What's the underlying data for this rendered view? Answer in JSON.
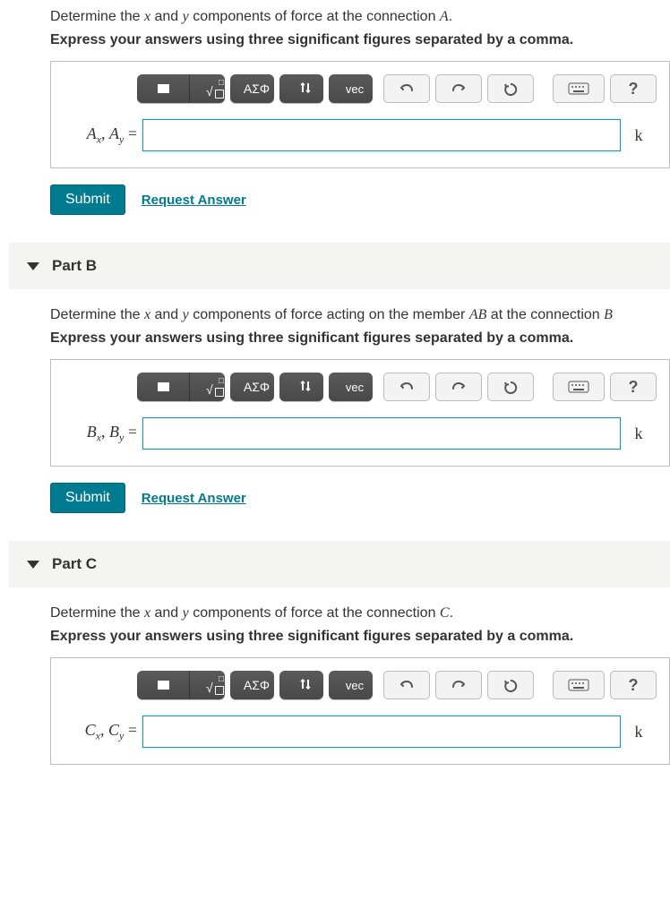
{
  "partA": {
    "prompt_pre": "Determine the ",
    "var1": "x",
    "mid1": " and ",
    "var2": "y",
    "prompt_mid": " components of force at the connection ",
    "conn": "A",
    "prompt_post": ".",
    "instruction": "Express your answers using three significant figures separated by a comma.",
    "lhs_html": "A_x, A_y =",
    "unit": "k",
    "submit": "Submit",
    "request": "Request Answer"
  },
  "partB": {
    "title": "Part B",
    "prompt_pre": "Determine the ",
    "var1": "x",
    "mid1": " and ",
    "var2": "y",
    "prompt_mid": " components of force acting on the member ",
    "member": "AB",
    "prompt_mid2": " at the connection ",
    "conn": "B",
    "instruction": "Express your answers using three significant figures separated by a comma.",
    "unit": "k",
    "submit": "Submit",
    "request": "Request Answer"
  },
  "partC": {
    "title": "Part C",
    "prompt_pre": "Determine the ",
    "var1": "x",
    "mid1": " and ",
    "var2": "y",
    "prompt_mid": " components of force at the connection ",
    "conn": "C",
    "prompt_post": ".",
    "instruction": "Express your answers using three significant figures separated by a comma.",
    "unit": "k"
  },
  "toolbar": {
    "templates_label": "▮",
    "greek_label": "ΑΣΦ",
    "vec_label": "vec",
    "help_label": "?"
  }
}
